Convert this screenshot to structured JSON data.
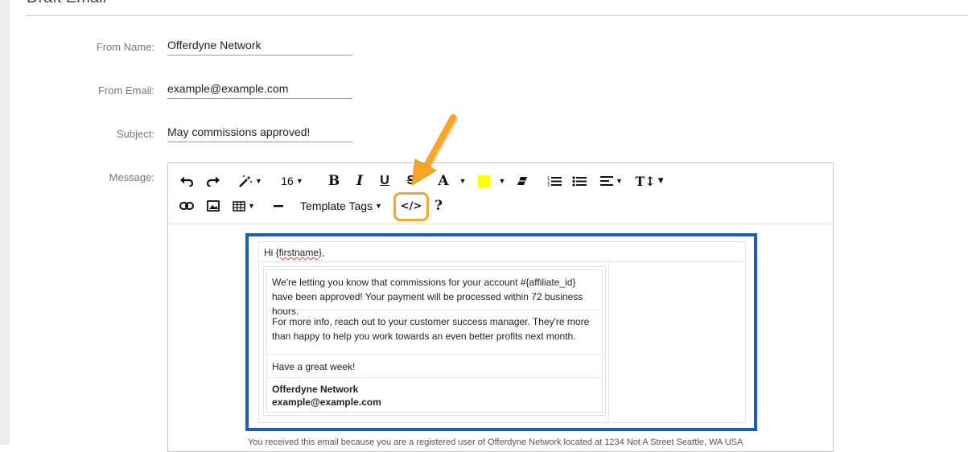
{
  "page": {
    "title": "Draft Email"
  },
  "form": {
    "from_name": {
      "label": "From Name:",
      "value": "Offerdyne Network"
    },
    "from_email": {
      "label": "From Email:",
      "value": "example@example.com"
    },
    "subject": {
      "label": "Subject:",
      "value": "May commissions approved!"
    },
    "message_label": "Message:"
  },
  "toolbar": {
    "font_size": "16",
    "bold": "B",
    "italic": "I",
    "underline": "U",
    "strike": "S",
    "font_color": "A",
    "highlight_color": "#ffff00",
    "line_height": "T↕",
    "template_tags": "Template Tags",
    "code_view": "</>",
    "help": "?",
    "icons": [
      "undo-icon",
      "redo-icon",
      "magic-icon",
      "eraser-icon",
      "ordered-list-icon",
      "unordered-list-icon",
      "align-icon",
      "link-icon",
      "image-icon",
      "table-icon",
      "horizontal-rule-icon"
    ]
  },
  "email": {
    "greeting_prefix": "Hi ",
    "greeting_tag": "{firstname}",
    "greeting_suffix": ",",
    "p1": "We're letting you know that commissions for your account #{affiliate_id} have been approved! Your payment will be processed within 72 business hours.",
    "p2": "For more info, reach out to your customer success manager. They're more than happy to help you work towards an even better profits next month.",
    "p3": "Have a great week!",
    "sig_name": "Offerdyne Network",
    "sig_email": "example@example.com"
  },
  "footer": {
    "text": "You received this email because you are a registered user of Offerdyne Network located at 1234 Not A Street Seattle, WA USA"
  },
  "colors": {
    "accent_blue": "#1661b5",
    "callout_orange": "#f5a623"
  }
}
